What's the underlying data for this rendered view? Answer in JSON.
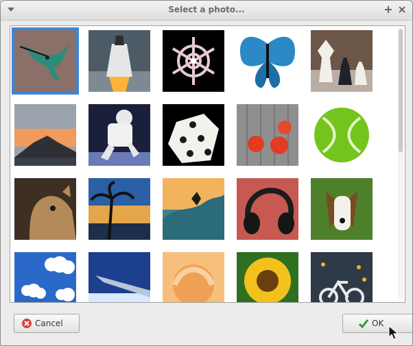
{
  "window": {
    "title": "Select a photo..."
  },
  "photos": [
    {
      "name": "hummingbird"
    },
    {
      "name": "space shuttle"
    },
    {
      "name": "snowflake"
    },
    {
      "name": "butterfly"
    },
    {
      "name": "chess pieces"
    },
    {
      "name": "mountain sunset"
    },
    {
      "name": "astronaut"
    },
    {
      "name": "die"
    },
    {
      "name": "tomatoes"
    },
    {
      "name": "tennis ball"
    },
    {
      "name": "cat"
    },
    {
      "name": "palm sunset"
    },
    {
      "name": "surfer"
    },
    {
      "name": "headphones"
    },
    {
      "name": "dog"
    },
    {
      "name": "clouds"
    },
    {
      "name": "airplane wing"
    },
    {
      "name": "rose"
    },
    {
      "name": "sunflower"
    },
    {
      "name": "bicycle sign"
    }
  ],
  "buttons": {
    "cancel": "Cancel",
    "ok": "OK"
  },
  "colors": {
    "selection": "#3b86d6"
  }
}
